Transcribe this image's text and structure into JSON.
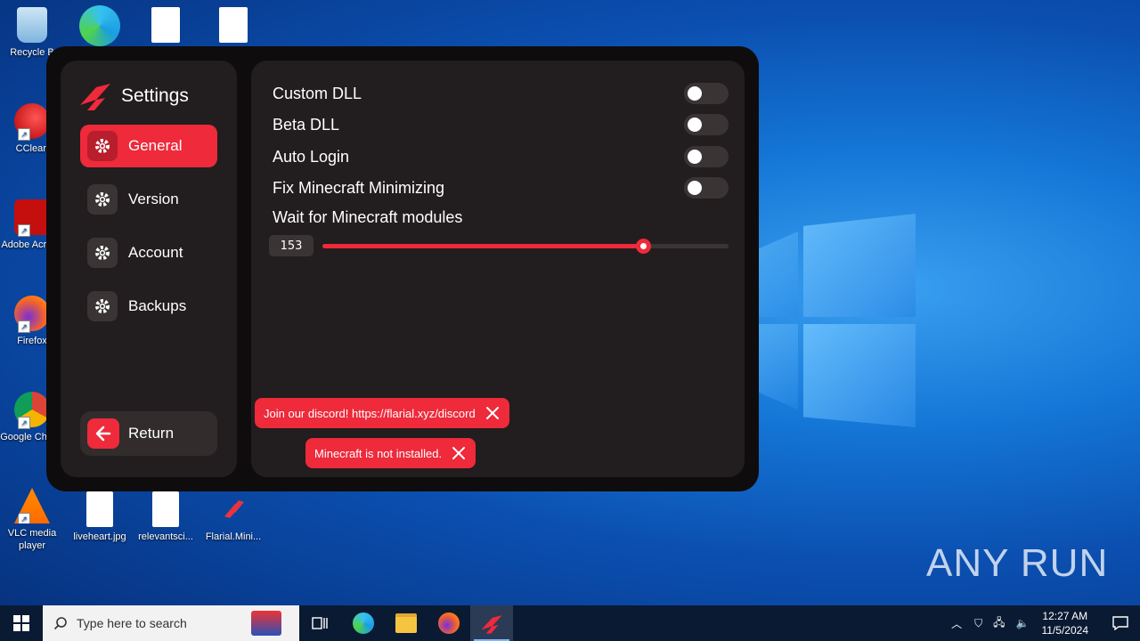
{
  "desktop": {
    "icons": [
      {
        "label": "Recycle B",
        "name": "recycle-bin"
      },
      {
        "label": "CClean",
        "name": "ccleaner"
      },
      {
        "label": "Adobe Acroba",
        "name": "adobe-acrobat"
      },
      {
        "label": "Firefox",
        "name": "firefox"
      },
      {
        "label": "Google Chrom",
        "name": "google-chrome"
      },
      {
        "label": "VLC media player",
        "name": "vlc"
      },
      {
        "label": "liveheart.jpg",
        "name": "liveheart"
      },
      {
        "label": "relevantsci...",
        "name": "relevantsci"
      },
      {
        "label": "Flarial.Mini...",
        "name": "flarial"
      }
    ],
    "watermark": "ANY RUN"
  },
  "app": {
    "title": "Settings",
    "accent": "#ee2a3b",
    "nav": [
      {
        "label": "General",
        "active": true
      },
      {
        "label": "Version",
        "active": false
      },
      {
        "label": "Account",
        "active": false
      },
      {
        "label": "Backups",
        "active": false
      }
    ],
    "return_label": "Return",
    "settings": [
      {
        "label": "Custom DLL",
        "on": false
      },
      {
        "label": "Beta DLL",
        "on": false
      },
      {
        "label": "Auto Login",
        "on": false
      },
      {
        "label": "Fix Minecraft Minimizing",
        "on": false
      }
    ],
    "slider": {
      "label": "Wait for Minecraft modules",
      "value": "153",
      "fraction": 0.79
    },
    "toasts": [
      {
        "text": "Join our discord! https://flarial.xyz/discord"
      },
      {
        "text": "Minecraft is not installed."
      }
    ]
  },
  "taskbar": {
    "search_placeholder": "Type here to search",
    "time": "12:27 AM",
    "date": "11/5/2024"
  }
}
